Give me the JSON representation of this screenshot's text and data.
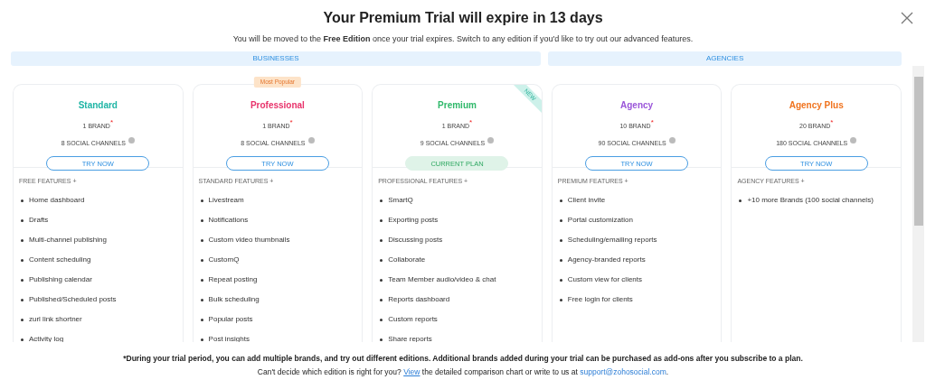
{
  "title": "Your Premium Trial will expire in 13 days",
  "subtitle": "You will be moved to the **Free Edition** once your trial expires. Switch to any edition if you'd like to try out our advanced features.",
  "groups": [
    {
      "label": "BUSINESSES"
    },
    {
      "label": "AGENCIES"
    }
  ],
  "plans": [
    {
      "name": "Standard",
      "color": "#1fb5a5",
      "brands": "1 BRAND",
      "brand_mark": "*",
      "channels": "8 SOCIAL CHANNELS",
      "button": {
        "label": "TRY NOW",
        "kind": "try"
      },
      "features_heading": "FREE FEATURES +",
      "features": [
        "Home dashboard",
        "Drafts",
        "Multi-channel publishing",
        "Content scheduling",
        "Publishing calendar",
        "Published/Scheduled posts",
        "zurl link shortner",
        "Activity log"
      ]
    },
    {
      "name": "Professional",
      "color": "#e8336b",
      "badge": "Most Popular",
      "brands": "1 BRAND",
      "brand_mark": "*",
      "channels": "8 SOCIAL CHANNELS",
      "button": {
        "label": "TRY NOW",
        "kind": "try"
      },
      "features_heading": "STANDARD FEATURES +",
      "features": [
        "Livestream",
        "Notifications",
        "Custom video thumbnails",
        "CustomQ",
        "Repeat posting",
        "Bulk scheduling",
        "Popular posts",
        "Post insights"
      ]
    },
    {
      "name": "Premium",
      "color": "#2fb86a",
      "ribbon": "NEW",
      "brands": "1 BRAND",
      "brand_mark": "*",
      "channels": "9 SOCIAL CHANNELS",
      "button": {
        "label": "CURRENT PLAN",
        "kind": "current"
      },
      "features_heading": "PROFESSIONAL FEATURES +",
      "features": [
        "SmartQ",
        "Exporting posts",
        "Discussing posts",
        "Collaborate",
        "Team Member audio/video & chat",
        "Reports dashboard",
        "Custom reports",
        "Share reports"
      ]
    },
    {
      "name": "Agency",
      "color": "#9a55d9",
      "brands": "10 BRAND",
      "brand_mark": "*",
      "channels": "90 SOCIAL CHANNELS",
      "button": {
        "label": "TRY NOW",
        "kind": "try"
      },
      "features_heading": "PREMIUM FEATURES +",
      "features": [
        "Client invite",
        "Portal customization",
        "Scheduling/emailing reports",
        "Agency-branded reports",
        "Custom view for clients",
        "Free login for clients"
      ]
    },
    {
      "name": "Agency Plus",
      "color": "#f0731e",
      "brands": "20 BRAND",
      "brand_mark": "*",
      "channels": "180 SOCIAL CHANNELS",
      "button": {
        "label": "TRY NOW",
        "kind": "try"
      },
      "features_heading": "AGENCY FEATURES +",
      "features": [
        "+10 more Brands (100 social channels)"
      ]
    }
  ],
  "footer": {
    "note": "*During your trial period, you can add multiple brands, and try out different editions. Additional brands added during your trial can be purchased as add-ons after you subscribe to a plan.",
    "help": [
      {
        "kind": "text",
        "text": "Can't decide which edition is right for you?"
      },
      {
        "kind": "link",
        "text": "View"
      },
      {
        "kind": "text",
        "text": "the detailed comparison chart or write to us at"
      },
      {
        "kind": "email",
        "text": "support@zohosocial.com"
      },
      {
        "kind": "text",
        "text": "."
      }
    ]
  }
}
